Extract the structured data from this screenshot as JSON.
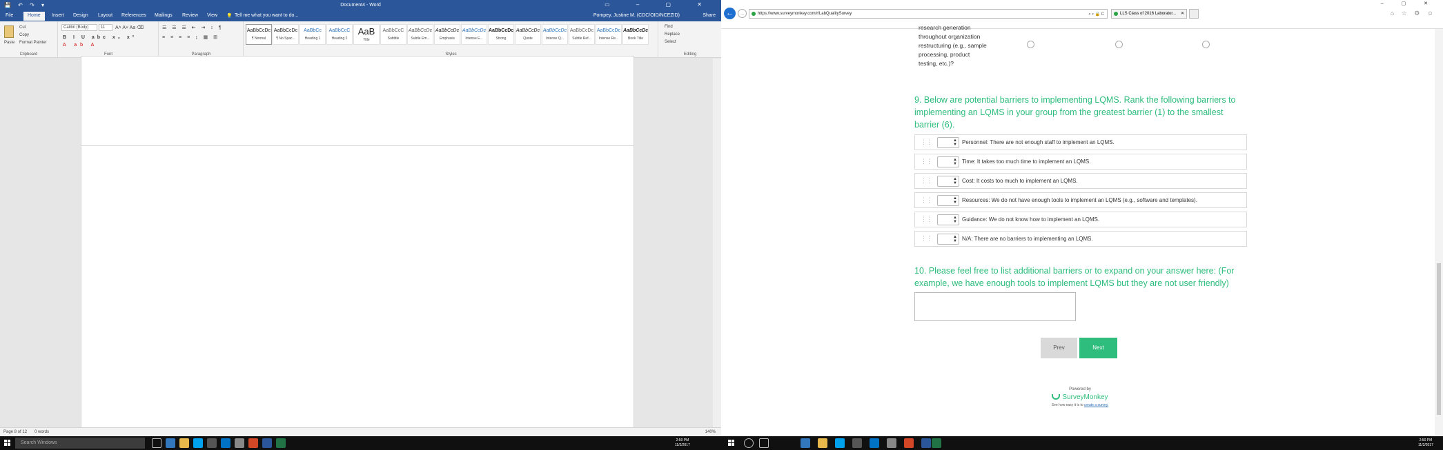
{
  "word": {
    "doc_title": "Document4 - Word",
    "quick_access": "💾 ↶ ↷ ▾",
    "tabs": [
      "File",
      "Home",
      "Insert",
      "Design",
      "Layout",
      "References",
      "Mailings",
      "Review",
      "View"
    ],
    "tell_me": "Tell me what you want to do...",
    "user": "Pompey, Justine M. (CDC/OID/NCEZID)",
    "share": "Share",
    "clipboard": {
      "paste": "Paste",
      "cut": "Cut",
      "copy": "Copy",
      "format_painter": "Format Painter",
      "label": "Clipboard"
    },
    "font": {
      "name": "Calibri (Body)",
      "size": "11",
      "label": "Font"
    },
    "paragraph_label": "Paragraph",
    "styles_label": "Styles",
    "editing": {
      "find": "Find",
      "replace": "Replace",
      "select": "Select",
      "label": "Editing"
    },
    "styles": [
      {
        "sample": "AaBbCcDc",
        "name": "¶ Normal"
      },
      {
        "sample": "AaBbCcDc",
        "name": "¶ No Spac..."
      },
      {
        "sample": "AaBbCc",
        "name": "Heading 1"
      },
      {
        "sample": "AaBbCcC",
        "name": "Heading 2"
      },
      {
        "sample": "AaB",
        "name": "Title"
      },
      {
        "sample": "AaBbCcC",
        "name": "Subtitle"
      },
      {
        "sample": "AaBbCcDc",
        "name": "Subtle Em..."
      },
      {
        "sample": "AaBbCcDc",
        "name": "Emphasis"
      },
      {
        "sample": "AaBbCcDc",
        "name": "Intense E..."
      },
      {
        "sample": "AaBbCcDc",
        "name": "Strong"
      },
      {
        "sample": "AaBbCcDc",
        "name": "Quote"
      },
      {
        "sample": "AaBbCcDc",
        "name": "Intense Q..."
      },
      {
        "sample": "AaBbCcDc",
        "name": "Subtle Ref..."
      },
      {
        "sample": "AaBbCcDc",
        "name": "Intense Re..."
      },
      {
        "sample": "AaBbCcDc",
        "name": "Book Title"
      }
    ],
    "status": {
      "page": "Page 8 of 12",
      "words": "0 words",
      "zoom": "140%"
    }
  },
  "browser": {
    "url": "https://www.surveymonkey.com/r/LabQualitySurvey",
    "tab_title": "LLS Class of 2016 Laborator...",
    "addr_actions": "⌕ ▾ 🔒 C"
  },
  "survey": {
    "prev_row_text": "research generation throughout organization restructuring (e.g., sample processing, product testing, etc.)?",
    "q9_title": "9. Below are potential barriers to implementing LQMS. Rank the following barriers to implementing an LQMS in your group from the greatest barrier (1) to the smallest barrier (6).",
    "rank_items": [
      "Personnel: There are not enough staff to implement an LQMS.",
      "Time: It takes too much time to implement an LQMS.",
      "Cost: It costs too much to implement an LQMS.",
      "Resources: We do not have enough tools to implement an LQMS (e.g., software and templates).",
      "Guidance: We do not know how to implement an LQMS.",
      "N/A: There are no barriers to implementing an LQMS."
    ],
    "q10_title": "10. Please feel free to list additional barriers or to expand on your answer here: (For example, we have enough tools to implement LQMS but they are not user friendly)",
    "prev_label": "Prev",
    "next_label": "Next",
    "powered_by": "Powered by",
    "brand": "SurveyMonkey",
    "footer_pre": "See how easy it is to",
    "footer_link": "create a survey."
  },
  "taskbar": {
    "search_placeholder": "Search Windows",
    "time": "2:50 PM",
    "date": "11/2/2017"
  }
}
